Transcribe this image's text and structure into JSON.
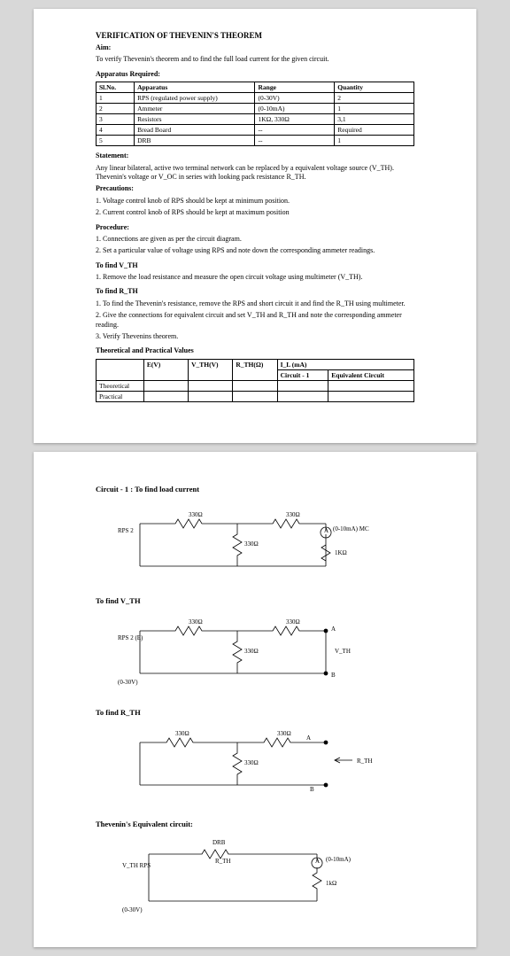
{
  "page1": {
    "title": "VERIFICATION OF THEVENIN'S THEOREM",
    "aim_h": "Aim:",
    "aim": "To verify Thevenin's theorem and to find the full load current for the given circuit.",
    "app_h": "Apparatus Required:",
    "app_headers": [
      "Sl.No.",
      "Apparatus",
      "Range",
      "Quantity"
    ],
    "app_rows": [
      [
        "1",
        "RPS (regulated power supply)",
        "(0-30V)",
        "2"
      ],
      [
        "2",
        "Ammeter",
        "(0-10mA)",
        "1"
      ],
      [
        "3",
        "Resistors",
        "1KΩ, 330Ω",
        "3,1"
      ],
      [
        "4",
        "Bread Board",
        "--",
        "Required"
      ],
      [
        "5",
        "DRB",
        "--",
        "1"
      ]
    ],
    "stmt_h": "Statement:",
    "stmt": "Any linear bilateral, active two terminal network can be replaced by a equivalent voltage source (V_TH). Thevenin's voltage or V_OC in series with looking pack resistance R_TH.",
    "prec_h": "Precautions:",
    "prec1": "1. Voltage control knob of RPS should be kept at minimum position.",
    "prec2": "2. Current control knob of RPS should be kept at maximum position",
    "proc_h": "Procedure:",
    "proc1": "1. Connections are given as per the circuit diagram.",
    "proc2": "2. Set a particular value of voltage using RPS and note down the corresponding ammeter readings.",
    "vth_h": "To find V_TH",
    "vth1": "1. Remove the load resistance and measure the open circuit voltage using multimeter (V_TH).",
    "rth_h": "To find R_TH",
    "rth1": "1. To find the Thevenin's resistance, remove the RPS and short circuit it and find the R_TH using multimeter.",
    "rth2": "2. Give the connections for equivalent circuit and set V_TH and R_TH and note the corresponding ammeter reading.",
    "rth3": "3. Verify Thevenins theorem.",
    "tab2_h": "Theoretical and Practical Values",
    "tab2_headers": [
      "",
      "E(V)",
      "V_TH(V)",
      "R_TH(Ω)",
      "I_L (mA)",
      ""
    ],
    "tab2_sub": [
      "Circuit - 1",
      "Equivalent Circuit"
    ],
    "tab2_rows": [
      "Theoretical",
      "Practical"
    ]
  },
  "page2": {
    "d1": "Circuit - 1 : To find load current",
    "d2": "To find V_TH",
    "d3": "To find R_TH",
    "d4": "Thevenin's Equivalent circuit:",
    "r330": "330Ω",
    "r1k": "1KΩ",
    "rps2": "RPS 2",
    "rpse": "RPS 2\n(E)",
    "v030": "(0-30V)",
    "amm": "(0-10mA)\nMC",
    "amm2": "(0-10mA)",
    "vth": "V_TH",
    "vthrps": "V_TH\nRPS",
    "rth": "R_TH",
    "drb": "DRB",
    "a": "A",
    "b": "B",
    "ap": "A",
    "bp": "B",
    "ik": "1kΩ"
  }
}
